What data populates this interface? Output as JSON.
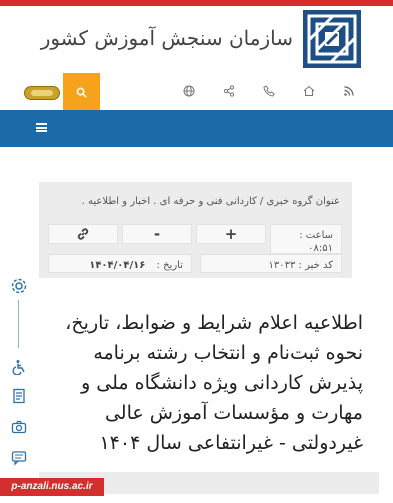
{
  "header": {
    "org_title": "سازمان سنجش آموزش کشور",
    "logo_icon": "sanjesh-logo",
    "accent_red": "#d32f2f",
    "brand_blue": "#1d4f86"
  },
  "toolbar": {
    "search_icon": "search-icon",
    "icons": [
      "globe-icon",
      "share-icon",
      "phone-icon",
      "home-icon",
      "rss-icon"
    ],
    "search_color": "#f7a21b"
  },
  "navbar": {
    "menu_icon": "hamburger-icon",
    "color": "#1d6aa8"
  },
  "news": {
    "breadcrumb": "عنوان گروه خبری / کاردانی فنی و حرفه ای . اخبار و اطلاعیه .",
    "time_label": "ساعت :",
    "time_value": "۰۸:۵۱",
    "increase_label": "+",
    "decrease_label": "-",
    "link_icon": "link-icon",
    "news_code_label": "کد خبر :",
    "news_code_value": "۱۳۰۳۳",
    "date_label": "تاریخ :",
    "date_value": "۱۴۰۴/۰۴/۱۶",
    "headline_lines": [
      "اطلاعیه اعلام شرایط و ضوابط، تاریخ،",
      "نحوه ثبت‌نام و انتخاب رشته برنامه",
      "پذیرش کاردانی ویژه دانشگاه ملی و",
      "مهارت و مؤسسات آموزش عالی",
      "غیردولتی - غیرانتفاعی سال ۱۴۰۴"
    ]
  },
  "side": {
    "icons": [
      "settings-icon",
      "accessibility-icon",
      "document-icon",
      "camera-icon",
      "chat-icon"
    ]
  },
  "footer": {
    "url": "p-anzali.nus.ac.ir"
  }
}
